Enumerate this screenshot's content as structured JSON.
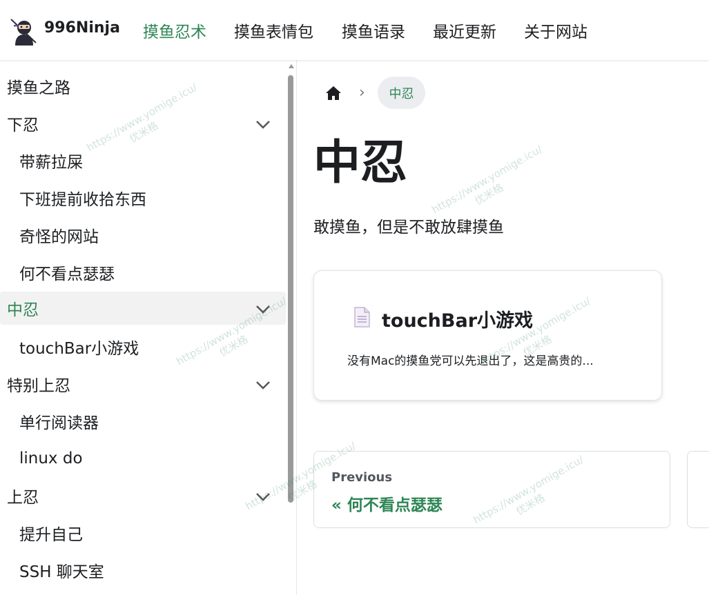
{
  "navbar": {
    "brand": "996Ninja",
    "links": [
      "摸鱼忍术",
      "摸鱼表情包",
      "摸鱼语录",
      "最近更新",
      "关于网站"
    ],
    "active": "摸鱼忍术"
  },
  "sidebar": {
    "items": [
      {
        "label": "摸鱼之路",
        "level": "top"
      },
      {
        "label": "下忍",
        "level": "top",
        "expandable": true
      },
      {
        "label": "带薪拉屎",
        "level": "sub"
      },
      {
        "label": "下班提前收拾东西",
        "level": "sub"
      },
      {
        "label": "奇怪的网站",
        "level": "sub"
      },
      {
        "label": "何不看点瑟瑟",
        "level": "sub"
      },
      {
        "label": "中忍",
        "level": "top",
        "expandable": true,
        "active": true
      },
      {
        "label": "touchBar小游戏",
        "level": "sub"
      },
      {
        "label": "特别上忍",
        "level": "top",
        "expandable": true
      },
      {
        "label": "单行阅读器",
        "level": "sub"
      },
      {
        "label": "linux do",
        "level": "sub"
      },
      {
        "label": "上忍",
        "level": "top",
        "expandable": true
      },
      {
        "label": "提升自己",
        "level": "sub"
      },
      {
        "label": "SSH 聊天室",
        "level": "sub"
      }
    ]
  },
  "breadcrumb": {
    "current": "中忍"
  },
  "page": {
    "title": "中忍",
    "description": "敢摸鱼，但是不敢放肆摸鱼"
  },
  "card": {
    "title": "touchBar小游戏",
    "description": "没有Mac的摸鱼党可以先退出了，这是高贵的..."
  },
  "pager": {
    "prev_sub": "Previous",
    "prev_label": "« 何不看点瑟瑟"
  },
  "watermark": {
    "url": "https://www.yomige.icu/",
    "name": "优米格"
  },
  "colors": {
    "accent": "#2e8555",
    "active_bg": "#f2f2f2"
  }
}
